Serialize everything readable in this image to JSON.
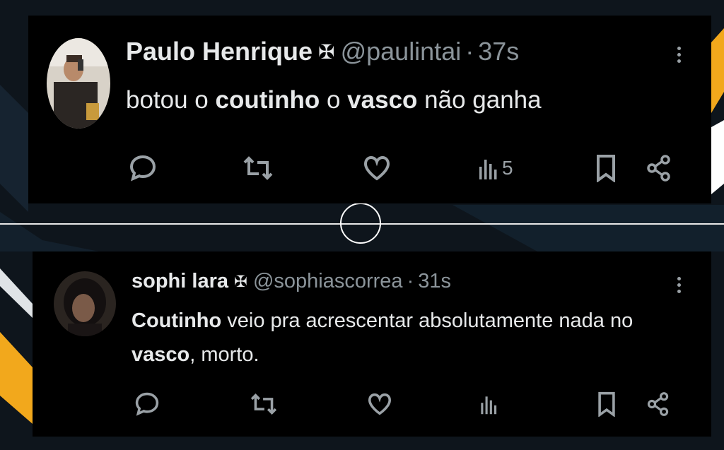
{
  "colors": {
    "background": "#0e151c",
    "card": "#000000",
    "text_primary": "#e7e9ea",
    "text_secondary": "#8b949a",
    "accent_yellow": "#f2a81c"
  },
  "tweets": [
    {
      "author_name": "Paulo Henrique",
      "badge_icon": "vasco-cross-icon",
      "handle": "@paulintai",
      "separator": "·",
      "time": "37s",
      "text_parts": [
        "botou o ",
        "coutinho",
        " o ",
        "vasco",
        " não ganha"
      ],
      "views": "5"
    },
    {
      "author_name": "sophi lara",
      "badge_icon": "vasco-cross-icon",
      "handle": "@sophiascorrea",
      "separator": "·",
      "time": "31s",
      "text_parts": [
        "Coutinho",
        " veio pra acrescentar absolutamente nada no ",
        "vasco",
        ", morto."
      ],
      "views": ""
    }
  ],
  "icons": [
    "reply-icon",
    "retweet-icon",
    "like-icon",
    "views-icon",
    "bookmark-icon",
    "share-icon",
    "more-icon"
  ]
}
